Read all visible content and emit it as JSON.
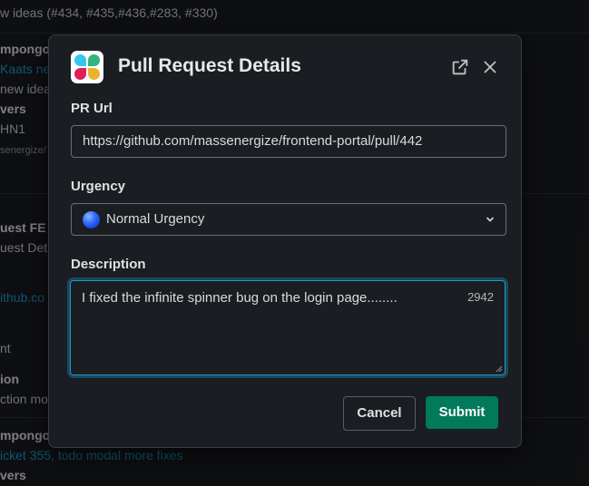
{
  "background": {
    "lines": [
      "w ideas (#434, #435,#436,#283, #330)",
      "mpongo",
      "Kaats ne",
      "new idea",
      "vers",
      "HN1",
      "senergize/",
      "uest FE",
      "uest Det",
      "ithub.co",
      "nt",
      "ion",
      "ction mod",
      "mpongo",
      "icket 355, todo modal more fixes",
      "vers"
    ]
  },
  "modal": {
    "title": "Pull Request Details",
    "fields": {
      "pr_url_label": "PR Url",
      "pr_url_value": "https://github.com/massenergize/frontend-portal/pull/442",
      "urgency_label": "Urgency",
      "urgency_value": "Normal Urgency",
      "description_label": "Description",
      "description_value": "I fixed the infinite spinner bug on the login page........",
      "description_char_count": "2942"
    },
    "buttons": {
      "cancel": "Cancel",
      "submit": "Submit"
    }
  },
  "colors": {
    "submit_green": "#007a5a",
    "focus_blue": "#1d9bd1",
    "urgency_dot_blue": "#2a64ff"
  },
  "icons": [
    "app-logo",
    "open-in-new-window-icon",
    "close-icon",
    "chevron-down-icon",
    "blue-circle-icon",
    "resize-handle-icon"
  ]
}
